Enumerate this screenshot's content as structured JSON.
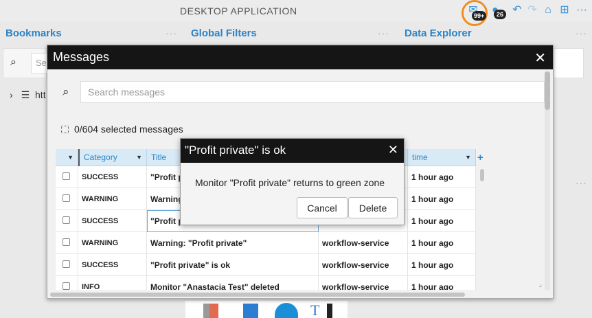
{
  "app": {
    "title": "DESKTOP APPLICATION"
  },
  "toolbar": {
    "mail_badge": "99+",
    "users_badge": "26",
    "more_label": "···",
    "icons": [
      "mail-icon",
      "users-icon",
      "undo-icon",
      "redo-icon",
      "home-icon",
      "add-window-icon",
      "more-icon"
    ]
  },
  "panels": [
    {
      "title": "Bookmarks",
      "more": "···"
    },
    {
      "title": "Global Filters",
      "more": "···"
    },
    {
      "title": "Data Explorer",
      "more": "···"
    }
  ],
  "background": {
    "search_placeholder": "Se",
    "tree_item": "htt",
    "side_more": "···"
  },
  "messages": {
    "title": "Messages",
    "close": "✕",
    "search_placeholder": "Search messages",
    "selected_count": "0/604 selected messages",
    "columns": {
      "category": "Category",
      "title": "Title",
      "time": "time"
    },
    "rows": [
      {
        "category": "SUCCESS",
        "title": "\"Profit p",
        "source": "",
        "time": "1 hour ago"
      },
      {
        "category": "WARNING",
        "title": "Warning",
        "source": "",
        "time": "1 hour ago"
      },
      {
        "category": "SUCCESS",
        "title": "\"Profit p",
        "source": "",
        "time": "1 hour ago"
      },
      {
        "category": "WARNING",
        "title": "Warning: \"Profit private\"",
        "source": "workflow-service",
        "time": "1 hour ago"
      },
      {
        "category": "SUCCESS",
        "title": "\"Profit private\" is ok",
        "source": "workflow-service",
        "time": "1 hour ago"
      },
      {
        "category": "INFO",
        "title": "Monitor \"Anastacia Test\" deleted",
        "source": "workflow-service",
        "time": "1 hour ago"
      }
    ]
  },
  "confirm": {
    "title": "\"Profit private\" is ok",
    "close": "✕",
    "text": "Monitor \"Profit private\" returns to green zone",
    "cancel_label": "Cancel",
    "delete_label": "Delete"
  }
}
